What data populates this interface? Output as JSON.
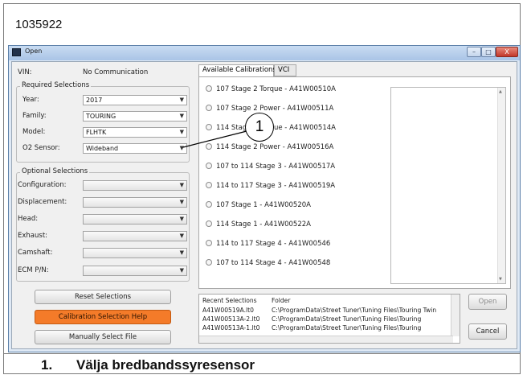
{
  "figure_id": "1035922",
  "callout_number": "1",
  "caption": {
    "number": "1.",
    "text": "Välja bredbandssyresensor"
  },
  "window": {
    "title": "Open",
    "controls": {
      "minimize": "–",
      "maximize": "□",
      "close": "X"
    },
    "vin": {
      "label": "VIN:",
      "value": "No Communication"
    },
    "required": {
      "legend": "Required Selections",
      "fields": [
        {
          "label": "Year:",
          "value": "2017"
        },
        {
          "label": "Family:",
          "value": "TOURING"
        },
        {
          "label": "Model:",
          "value": "FLHTK"
        },
        {
          "label": "O2 Sensor:",
          "value": "Wideband"
        }
      ]
    },
    "optional": {
      "legend": "Optional Selections",
      "fields": [
        {
          "label": "Configuration:",
          "value": ""
        },
        {
          "label": "Displacement:",
          "value": ""
        },
        {
          "label": "Head:",
          "value": ""
        },
        {
          "label": "Exhaust:",
          "value": ""
        },
        {
          "label": "Camshaft:",
          "value": ""
        },
        {
          "label": "ECM P/N:",
          "value": ""
        }
      ]
    },
    "buttons": {
      "reset": "Reset Selections",
      "help": "Calibration Selection Help",
      "manual": "Manually Select File",
      "open": "Open",
      "cancel": "Cancel"
    },
    "tabs": [
      "Available Calibrations",
      "VCI"
    ],
    "calibrations": [
      "107 Stage 2 Torque - A41W00510A",
      "107 Stage 2 Power - A41W00511A",
      "114 Stage 2 Torque - A41W00514A",
      "114 Stage 2 Power - A41W00516A",
      "107 to 114 Stage 3 - A41W00517A",
      "114 to 117 Stage 3 - A41W00519A",
      "107 Stage 1 - A41W00520A",
      "114 Stage 1 - A41W00522A",
      "114 to 117 Stage 4 - A41W00546",
      "107 to 114 Stage 4 - A41W00548"
    ],
    "recent": {
      "headers": [
        "Recent Selections",
        "Folder"
      ],
      "rows": [
        [
          "A41W00519A.lt0",
          "C:\\ProgramData\\Street Tuner\\Tuning Files\\Touring Twin"
        ],
        [
          "A41W00513A-2.lt0",
          "C:\\ProgramData\\Street Tuner\\Tuning Files\\Touring"
        ],
        [
          "A41W00513A-1.lt0",
          "C:\\ProgramData\\Street Tuner\\Tuning Files\\Touring"
        ]
      ]
    }
  },
  "colors": {
    "accent": "#f47b29",
    "title_bar": "#b9d1ee",
    "close": "#c2372a"
  }
}
